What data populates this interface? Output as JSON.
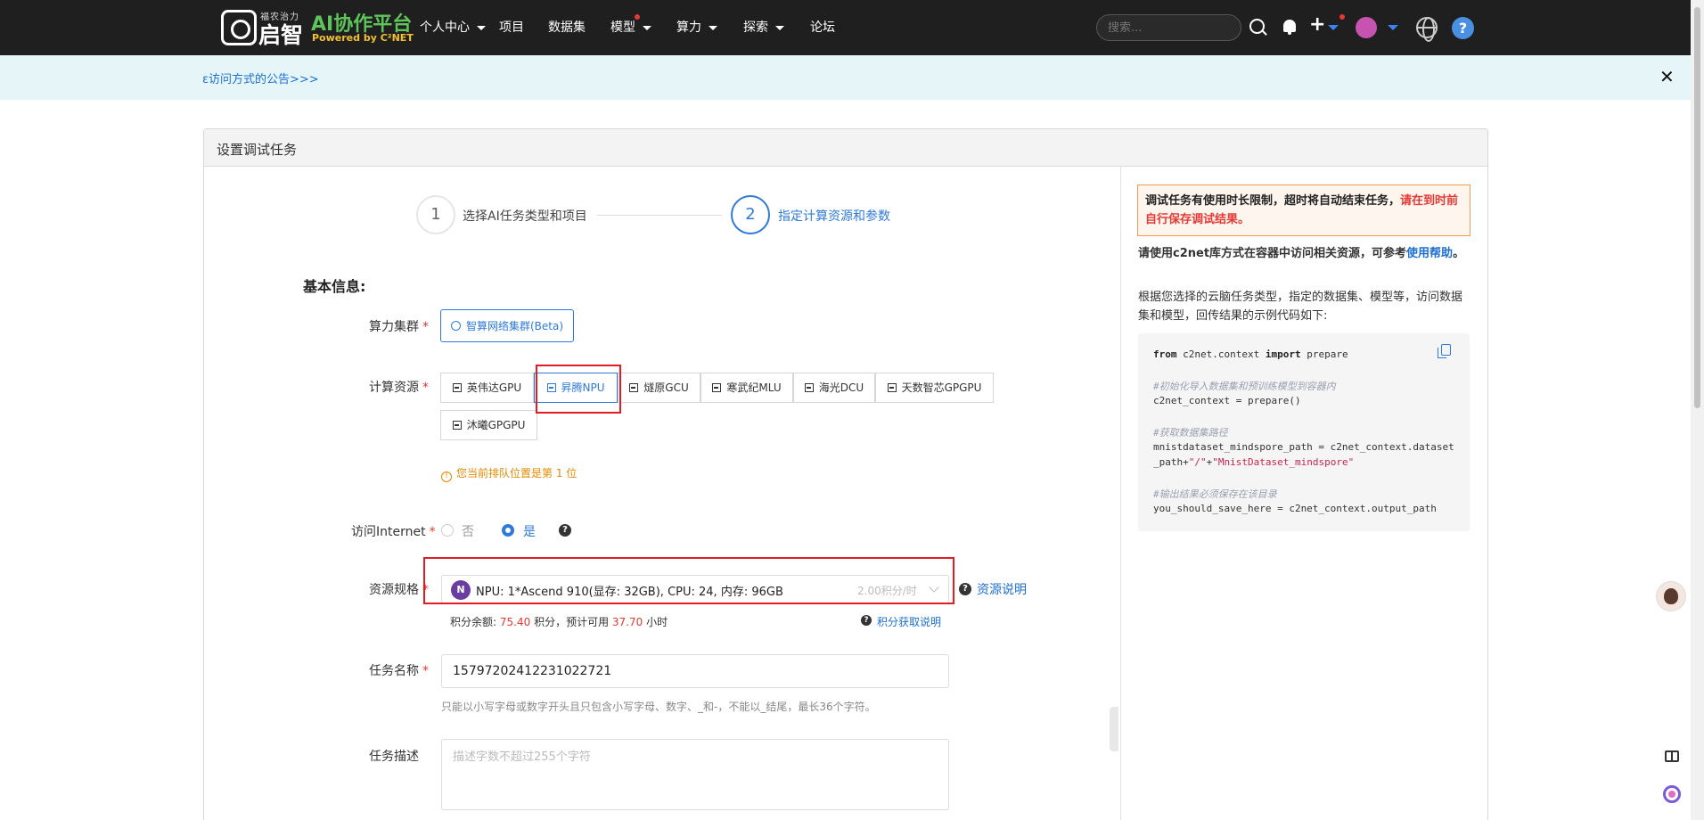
{
  "header": {
    "logo_tagline": "福农治力",
    "logo_name": "启智",
    "brand_title": "AI协作平台",
    "brand_subtitle": "Powered by C²NET",
    "nav": [
      {
        "label": "个人中心"
      },
      {
        "label": "项目"
      },
      {
        "label": "数据集"
      },
      {
        "label": "模型"
      },
      {
        "label": "算力"
      },
      {
        "label": "探索"
      },
      {
        "label": "论坛"
      }
    ],
    "search_placeholder": "搜索...",
    "help_label": "?"
  },
  "announcement": {
    "text": "ɛ访问方式的公告>>>",
    "close_label": "✕"
  },
  "card": {
    "title": "设置调试任务"
  },
  "steps": [
    {
      "number": "1",
      "label": "选择AI任务类型和项目"
    },
    {
      "number": "2",
      "label": "指定计算资源和参数"
    }
  ],
  "form": {
    "section_title": "基本信息:",
    "cluster_label": "算力集群",
    "cluster_button": "智算网络集群(Beta)",
    "compute_label": "计算资源",
    "compute_options": [
      {
        "label": "英伟达GPU"
      },
      {
        "label": "昇腾NPU"
      },
      {
        "label": "燧原GCU"
      },
      {
        "label": "寒武纪MLU"
      },
      {
        "label": "海光DCU"
      },
      {
        "label": "天数智芯GPGPU"
      },
      {
        "label": "沐曦GPGPU"
      }
    ],
    "compute_selected": "昇腾NPU",
    "queue_notice": "您当前排队位置是第 1 位",
    "internet_label": "访问Internet",
    "internet_options": [
      "否",
      "是"
    ],
    "internet_selected": "是",
    "spec_label": "资源规格",
    "spec_badge": "N",
    "spec_value": "NPU: 1*Ascend 910(显存: 32GB), CPU: 24, 内存: 96GB",
    "spec_price": "2.00积分/时",
    "spec_help_link": "资源说明",
    "balance_prefix": "积分余额:",
    "balance_value": "75.40",
    "balance_mid": "积分，预计可用",
    "balance_hours": "37.70",
    "balance_suffix": "小时",
    "points_link": "积分获取说明",
    "task_name_label": "任务名称",
    "task_name_value": "15797202412231022721",
    "task_name_hint": "只能以小写字母或数字开头且只包含小写字母、数字、_和-，不能以_结尾，最长36个字符。",
    "task_desc_label": "任务描述",
    "task_desc_placeholder": "描述字数不超过255个字符",
    "required_mark": "*"
  },
  "side_panel": {
    "notice_black": "调试任务有使用时长限制，超时将自动结束任务，",
    "notice_red": "请在到时前自行保存调试结果。",
    "usage_text": "请使用c2net库方式在容器中访问相关资源，可参考",
    "usage_link": "使用帮助",
    "usage_end": "。",
    "desc_text": "根据您选择的云脑任务类型，指定的数据集、模型等，访问数据集和模型，回传结果的示例代码如下:",
    "code": {
      "line1_from": "from",
      "line1_mid": " c2net.context ",
      "line1_import": "import",
      "line1_end": " prepare",
      "comment1": "#初始化导入数据集和预训练模型到容器内",
      "line2": "c2net_context = prepare()",
      "comment2": "#获取数据集路径",
      "line3a": "mnistdataset_mindspore_path = c2net_context.dataset",
      "line3b_pre": "_path+",
      "line3b_s1": "\"/\"",
      "line3b_plus": "+",
      "line3b_s2": "\"MnistDataset_mindspore\"",
      "comment3": "#输出结果必须保存在该目录",
      "line4": "you_should_save_here = c2net_context.output_path"
    }
  },
  "colors": {
    "accent": "#2f7ad8",
    "highlight_box": "#e31b23",
    "warning": "#e68a00",
    "brand_green": "#5ec45a"
  }
}
